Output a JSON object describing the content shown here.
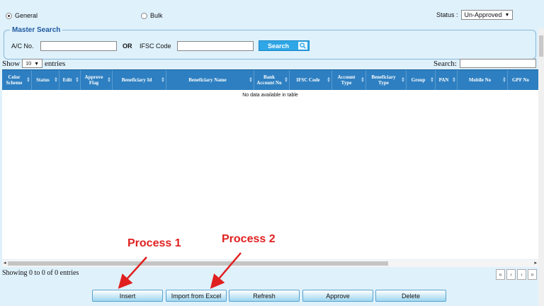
{
  "top": {
    "radio_general": "General",
    "radio_bulk": "Bulk",
    "status_label": "Status :",
    "status_value": "Un-Approved"
  },
  "master_search": {
    "legend": "Master Search",
    "ac_label": "A/C No.",
    "or_label": "OR",
    "ifsc_label": "IFSC Code",
    "search_button": "Search"
  },
  "table_controls": {
    "show_label": "Show",
    "entries_value": "10",
    "entries_label": "entries",
    "search_label": "Search:"
  },
  "columns": [
    "Color Scheme",
    "Status",
    "Edit",
    "Approve Flag",
    "Beneficiary Id",
    "Beneficiary Name",
    "Bank Account No",
    "IFSC Code",
    "Account Type",
    "Beneficiary Type",
    "Group",
    "PAN",
    "Mobile No",
    "GPF No"
  ],
  "empty_message": "No data available in table",
  "info_text": "Showing 0 to 0 of 0 entries",
  "pager": [
    "«",
    "‹",
    "›",
    "»"
  ],
  "buttons": {
    "insert": "Insert",
    "import_excel": "Import from Excel",
    "refresh": "Refresh",
    "approve": "Approve",
    "delete": "Delete"
  },
  "annotations": {
    "process1": "Process 1",
    "process2": "Process 2",
    "color": "#e02020"
  }
}
